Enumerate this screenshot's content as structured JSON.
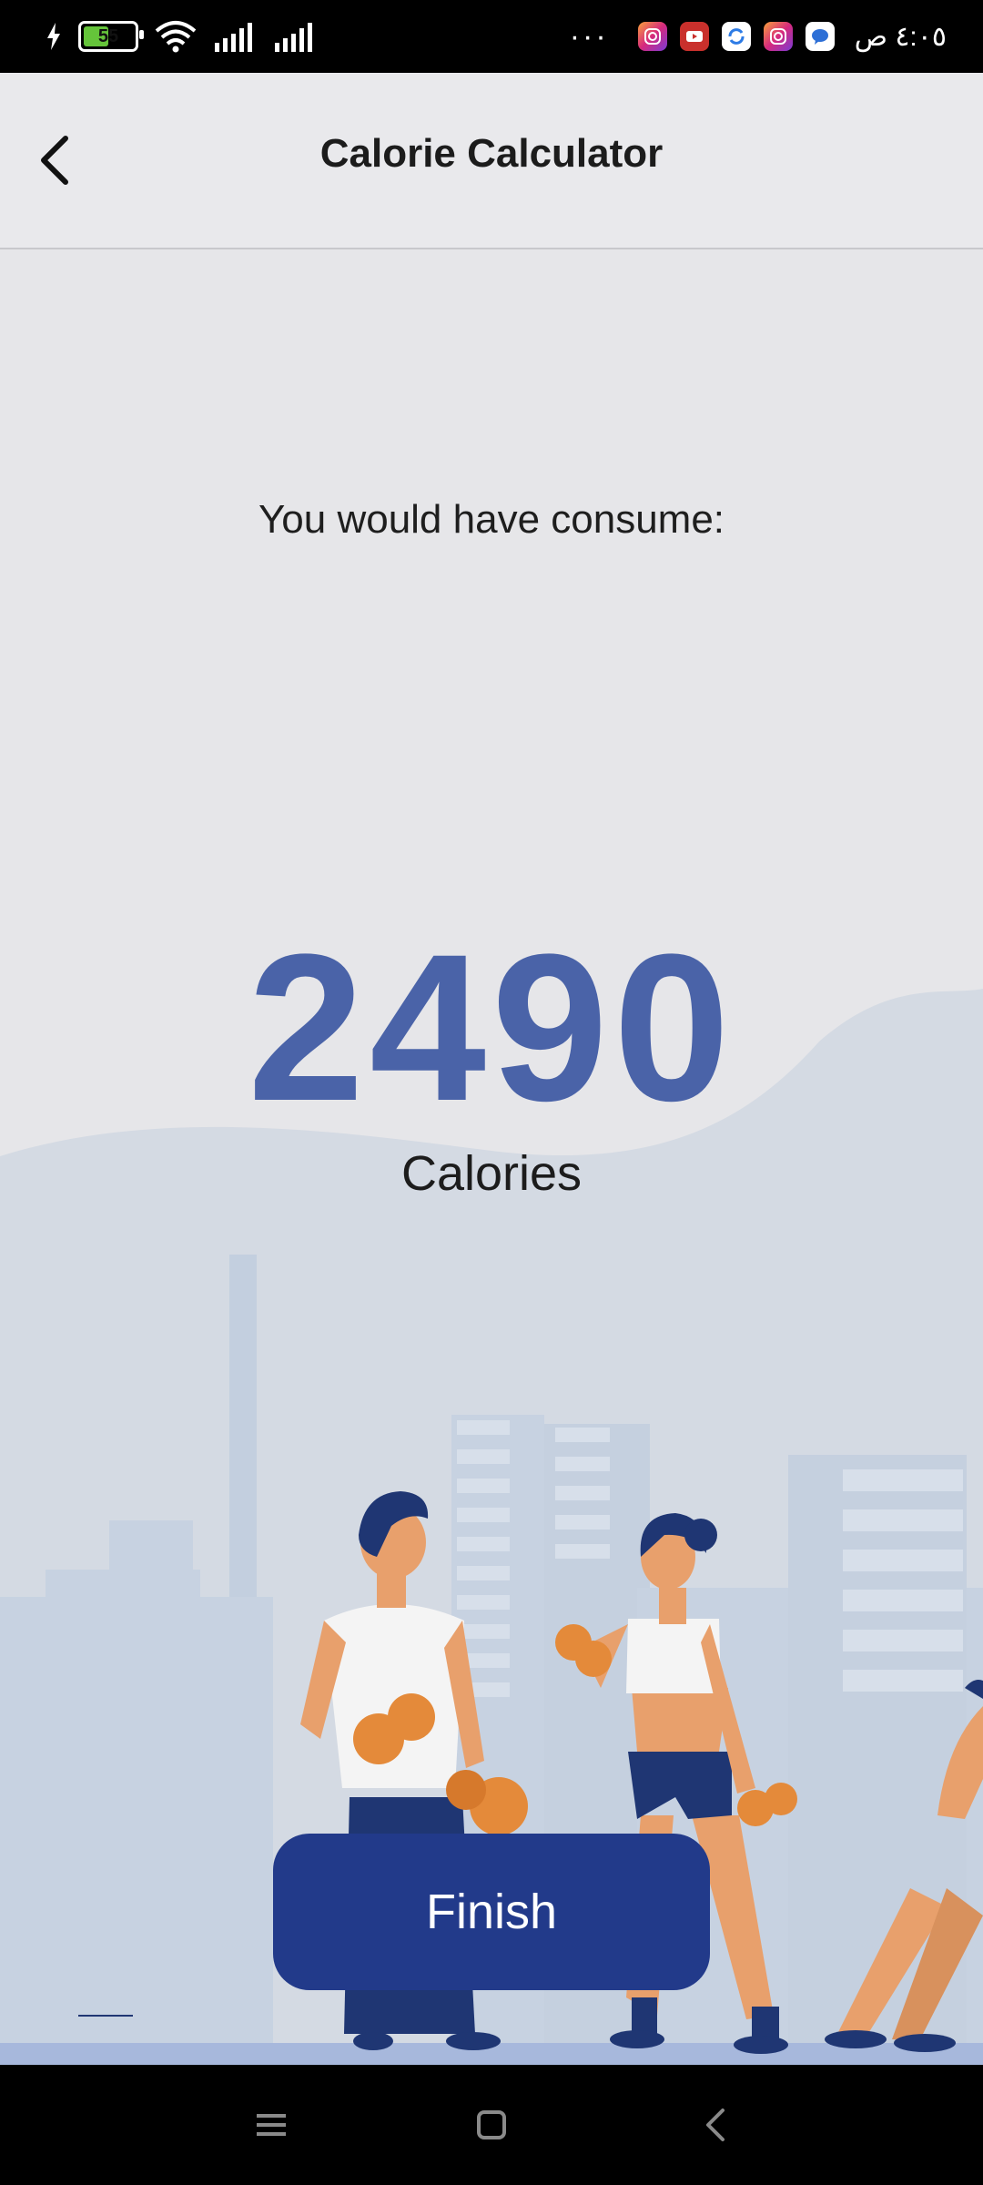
{
  "status_bar": {
    "battery_level": "55",
    "time": "٤:٠٥ ص",
    "overflow": "···",
    "notification_icons": [
      "instagram-icon",
      "youtube-icon",
      "sync-app-icon",
      "instagram-icon",
      "messenger-icon"
    ]
  },
  "header": {
    "title": "Calorie Calculator"
  },
  "result": {
    "label": "You would have consume:",
    "value": "2490",
    "unit": "Calories"
  },
  "actions": {
    "finish_label": "Finish"
  },
  "colors": {
    "accent": "#4a63a8",
    "button": "#223a8a",
    "background": "#e6e6e9",
    "illustration_bg": "#d4dae3"
  }
}
